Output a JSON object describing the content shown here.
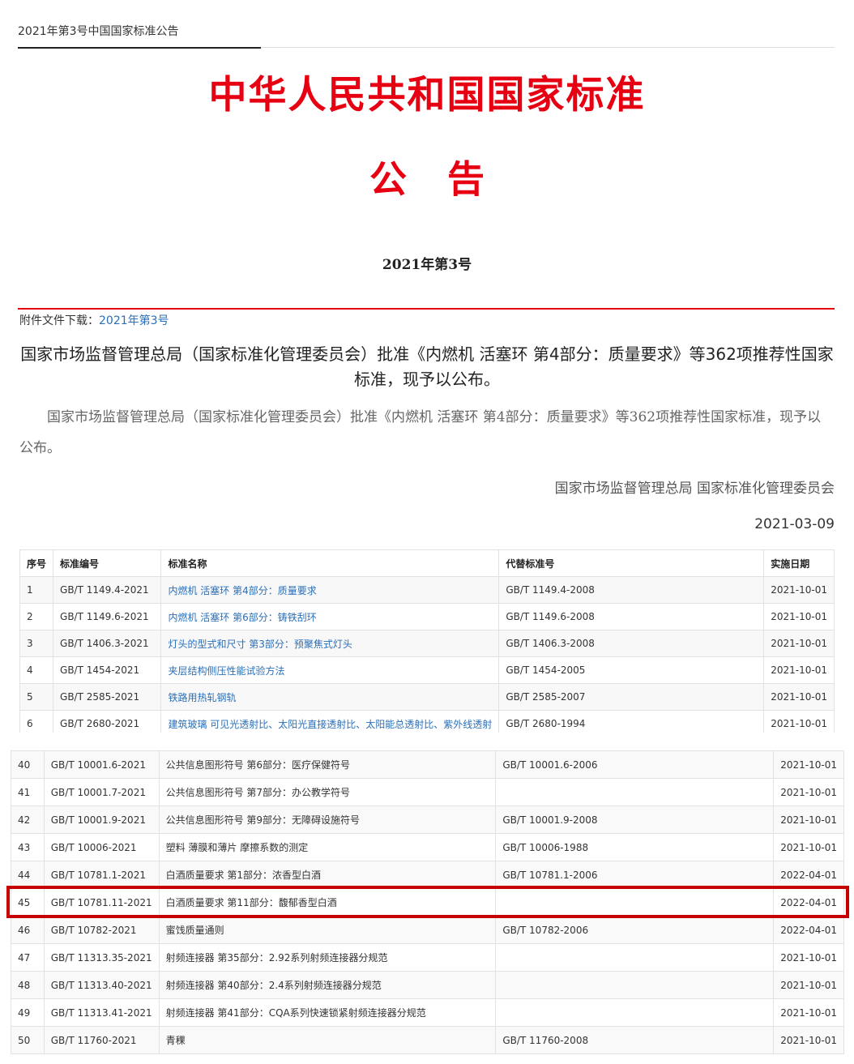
{
  "tab": {
    "label": "2021年第3号中国国家标准公告"
  },
  "title": "中华人民共和国国家标准",
  "notice": "公告",
  "issue_no": "2021年第3号",
  "attachment": {
    "label": "附件文件下载：",
    "link": "2021年第3号"
  },
  "headline": "国家市场监督管理总局（国家标准化管理委员会）批准《内燃机 活塞环 第4部分：质量要求》等362项推荐性国家标准，现予以公布。",
  "body": "国家市场监督管理总局（国家标准化管理委员会）批准《内燃机 活塞环 第4部分：质量要求》等362项推荐性国家标准，现予以公布。",
  "signer": "国家市场监督管理总局 国家标准化管理委员会",
  "date": "2021-03-09",
  "table_headers": [
    "序号",
    "标准编号",
    "标准名称",
    "代替标准号",
    "实施日期"
  ],
  "table_top": [
    [
      "1",
      "GB/T 1149.4-2021",
      "内燃机 活塞环 第4部分：质量要求",
      "GB/T 1149.4-2008",
      "2021-10-01"
    ],
    [
      "2",
      "GB/T 1149.6-2021",
      "内燃机 活塞环 第6部分：铸铁刮环",
      "GB/T 1149.6-2008",
      "2021-10-01"
    ],
    [
      "3",
      "GB/T 1406.3-2021",
      "灯头的型式和尺寸 第3部分：预聚焦式灯头",
      "GB/T 1406.3-2008",
      "2021-10-01"
    ],
    [
      "4",
      "GB/T 1454-2021",
      "夹层结构侧压性能试验方法",
      "GB/T 1454-2005",
      "2021-10-01"
    ],
    [
      "5",
      "GB/T 2585-2021",
      "铁路用热轧钢轨",
      "GB/T 2585-2007",
      "2021-10-01"
    ],
    [
      "6",
      "GB/T 2680-2021",
      "建筑玻璃 可见光透射比、太阳光直接透射比、太阳能总透射比、紫外线透射",
      "GB/T 2680-1994",
      "2021-10-01"
    ]
  ],
  "table_bottom": [
    [
      "40",
      "GB/T 10001.6-2021",
      "公共信息图形符号 第6部分：医疗保健符号",
      "GB/T 10001.6-2006",
      "2021-10-01"
    ],
    [
      "41",
      "GB/T 10001.7-2021",
      "公共信息图形符号 第7部分：办公教学符号",
      "",
      "2021-10-01"
    ],
    [
      "42",
      "GB/T 10001.9-2021",
      "公共信息图形符号 第9部分：无障碍设施符号",
      "GB/T 10001.9-2008",
      "2021-10-01"
    ],
    [
      "43",
      "GB/T 10006-2021",
      "塑料 薄膜和薄片 摩擦系数的测定",
      "GB/T 10006-1988",
      "2021-10-01"
    ],
    [
      "44",
      "GB/T 10781.1-2021",
      "白酒质量要求 第1部分：浓香型白酒",
      "GB/T 10781.1-2006",
      "2022-04-01"
    ],
    [
      "45",
      "GB/T 10781.11-2021",
      "白酒质量要求 第11部分：馥郁香型白酒",
      "",
      "2022-04-01"
    ],
    [
      "46",
      "GB/T 10782-2021",
      "蜜饯质量通则",
      "GB/T 10782-2006",
      "2022-04-01"
    ],
    [
      "47",
      "GB/T 11313.35-2021",
      "射频连接器 第35部分：2.92系列射频连接器分规范",
      "",
      "2021-10-01"
    ],
    [
      "48",
      "GB/T 11313.40-2021",
      "射频连接器 第40部分：2.4系列射频连接器分规范",
      "",
      "2021-10-01"
    ],
    [
      "49",
      "GB/T 11313.41-2021",
      "射频连接器 第41部分：CQA系列快速锁紧射频连接器分规范",
      "",
      "2021-10-01"
    ],
    [
      "50",
      "GB/T 11760-2021",
      "青稞",
      "GB/T 11760-2008",
      "2021-10-01"
    ]
  ]
}
